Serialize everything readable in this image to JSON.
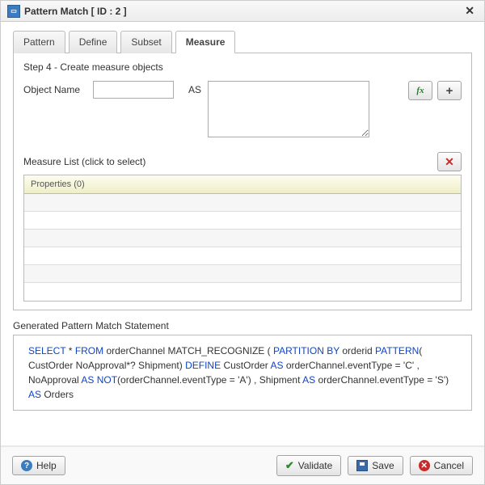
{
  "title": "Pattern Match [ ID : 2 ]",
  "tabs": [
    "Pattern",
    "Define",
    "Subset",
    "Measure"
  ],
  "active_tab": 3,
  "step_title": "Step 4 - Create measure objects",
  "object_name_label": "Object Name",
  "as_label": "AS",
  "object_name_value": "",
  "as_value": "",
  "measure_list_label": "Measure List (click to select)",
  "grid_header": "Properties (0)",
  "gen_label": "Generated Pattern Match Statement",
  "stmt": {
    "pre": "",
    "p": [
      {
        "t": "SELECT",
        "k": true
      },
      {
        "t": " * "
      },
      {
        "t": "FROM",
        "k": true
      },
      {
        "t": " orderChannel  MATCH_RECOGNIZE ( "
      },
      {
        "t": "PARTITION BY",
        "k": true
      },
      {
        "t": " orderid "
      },
      {
        "t": "PATTERN",
        "k": true
      },
      {
        "t": "( CustOrder NoApproval*? Shipment) "
      },
      {
        "t": "DEFINE",
        "k": true
      },
      {
        "t": " CustOrder "
      },
      {
        "t": "AS",
        "k": true
      },
      {
        "t": " orderChannel.eventType = 'C' , NoApproval "
      },
      {
        "t": "AS NOT",
        "k": true
      },
      {
        "t": "(orderChannel.eventType = 'A') , Shipment "
      },
      {
        "t": "AS",
        "k": true
      },
      {
        "t": " orderChannel.eventType = 'S') "
      },
      {
        "t": "AS",
        "k": true
      },
      {
        "t": " Orders"
      }
    ]
  },
  "btn_help": "Help",
  "btn_validate": "Validate",
  "btn_save": "Save",
  "btn_cancel": "Cancel"
}
